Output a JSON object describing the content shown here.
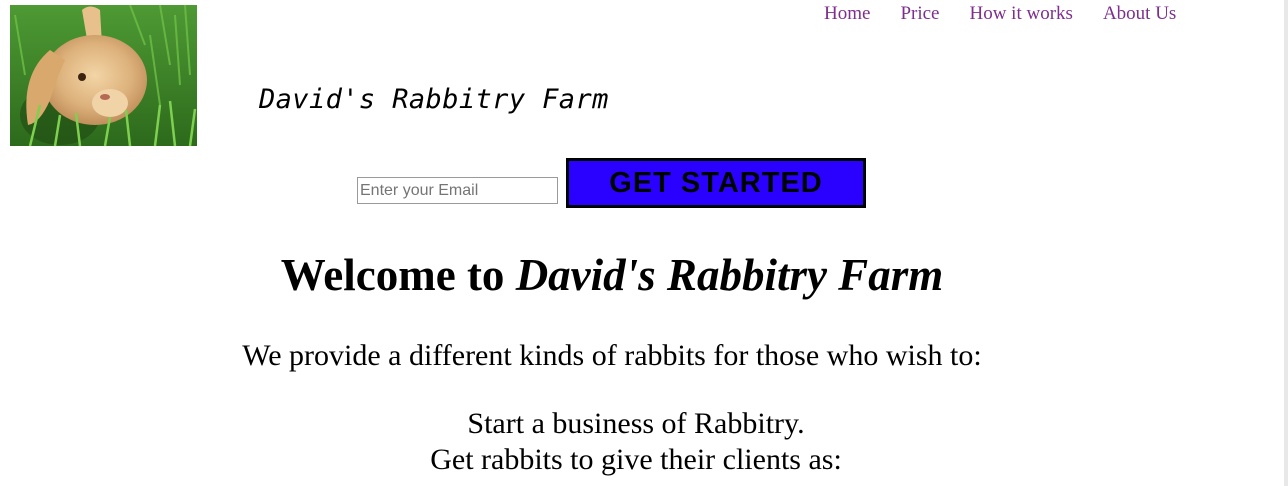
{
  "logo": {
    "alt": "rabbit photo"
  },
  "nav": {
    "items": [
      {
        "label": "Home"
      },
      {
        "label": "Price"
      },
      {
        "label": "How it works"
      },
      {
        "label": "About Us"
      }
    ],
    "link_color": "#7d2e8e"
  },
  "header": {
    "site_title": "David's Rabbitry Farm"
  },
  "signup": {
    "email_placeholder": "Enter your Email",
    "button_label": "GET STARTED",
    "button_color": "#2a00ff"
  },
  "main": {
    "welcome_prefix": "Welcome to ",
    "welcome_name": "David's Rabbitry Farm",
    "intro": "We provide a different kinds of rabbits for those who wish to:",
    "list": [
      "Start a business of Rabbitry.",
      "Get rabbits to give their clients as:"
    ]
  }
}
